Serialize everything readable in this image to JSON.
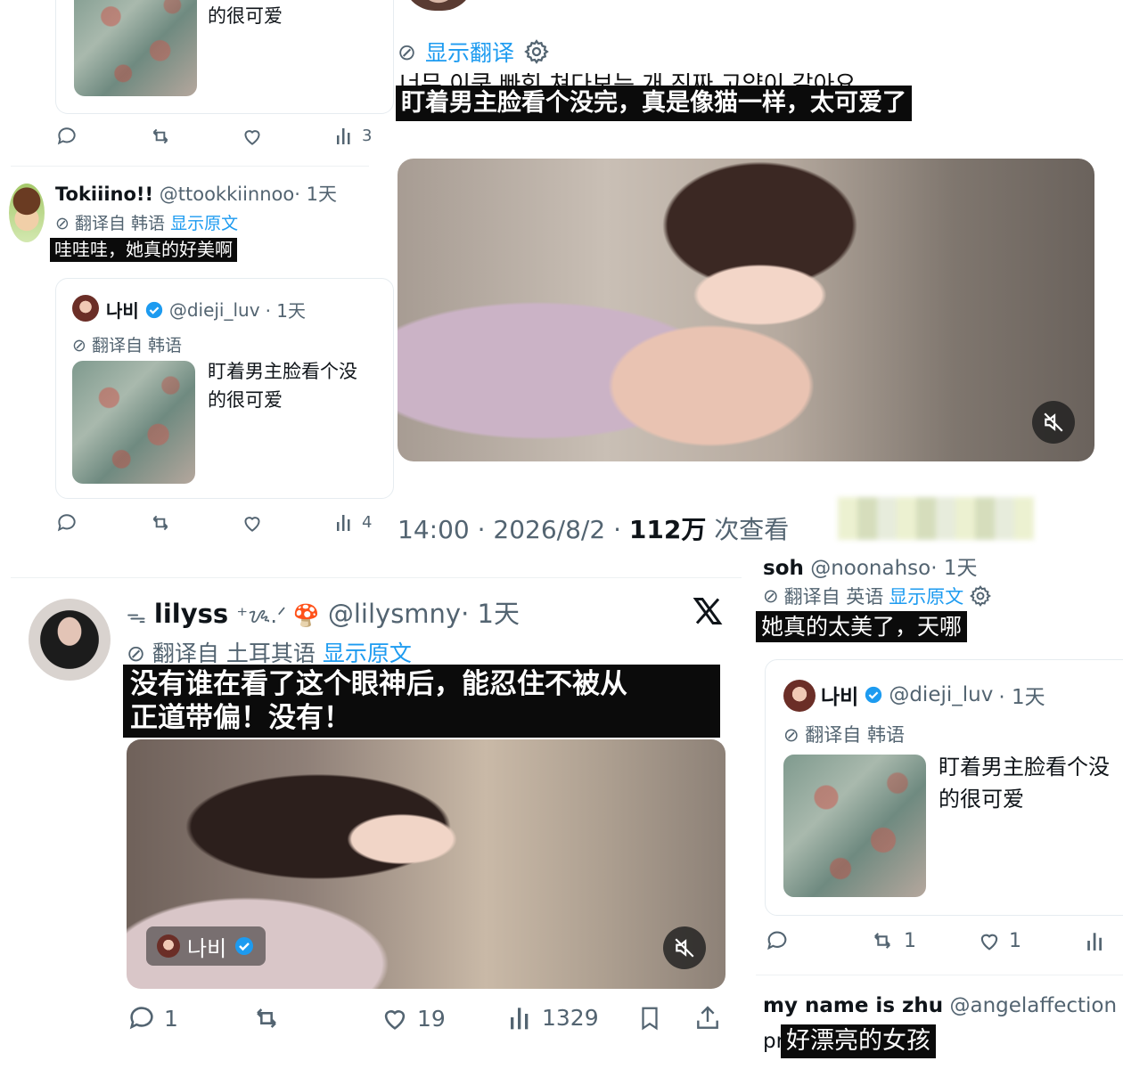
{
  "left_top": {
    "quoted_text_tail": "的很可爱",
    "actions": {
      "views": "3"
    }
  },
  "tweet_toki": {
    "name": "Tokiiino!!",
    "handle": "@ttookkiinnoo",
    "time": "· 1天",
    "translated_from": "翻译自 韩语",
    "show_original": "显示原文",
    "text": "哇哇哇，她真的好美啊",
    "quote": {
      "name": "나비",
      "handle": "@dieji_luv",
      "time": "· 1天",
      "translated_from": "翻译自 韩语",
      "text_line1": "盯着男主脸看个没",
      "text_line2": "的很可爱"
    },
    "actions": {
      "views": "4"
    }
  },
  "main_tweet": {
    "show_translation": "显示翻译",
    "korean_partial": "너무 이쿤 빠힌 쳐다보는 개 진짜 고양이 같아요",
    "caption": "盯着男主脸看个没完，真是像猫一样，太可爱了",
    "time": "14:00",
    "date": "2026/8/2",
    "views_count": "112万",
    "views_label": "次查看"
  },
  "tweet_lilyss": {
    "name": "lilyss",
    "name_deco": "⁺ᝰ.ᐟ 🍄",
    "handle": "@lilysmny",
    "time": "· 1天",
    "translated_from": "翻译自 土耳其语",
    "show_original": "显示原文",
    "caption_line1": "没有谁在看了这个眼神后，能忍住不被从",
    "caption_line2": "正道带偏！没有！",
    "video_tag": "나비",
    "actions": {
      "replies": "1",
      "likes": "19",
      "views": "1329"
    }
  },
  "tweet_soh": {
    "name": "soh",
    "handle": "@noonahso",
    "time": "· 1天",
    "translated_from": "翻译自 英语",
    "show_original": "显示原文",
    "caption": "她真的太美了，天哪",
    "quote": {
      "name": "나비",
      "handle": "@dieji_luv",
      "time": "· 1天",
      "translated_from": "翻译自 韩语",
      "text_line1": "盯着男主脸看个没",
      "text_line2": "的很可爱"
    },
    "actions": {
      "retweets": "1",
      "likes": "1"
    }
  },
  "tweet_zhu": {
    "name": "my name is zhu",
    "handle": "@angelaffection",
    "prefix": "pr",
    "caption": "好漂亮的女孩"
  },
  "colors": {
    "link": "#1d9bf0",
    "muted": "#536471",
    "verified": "#1d9bf0"
  }
}
